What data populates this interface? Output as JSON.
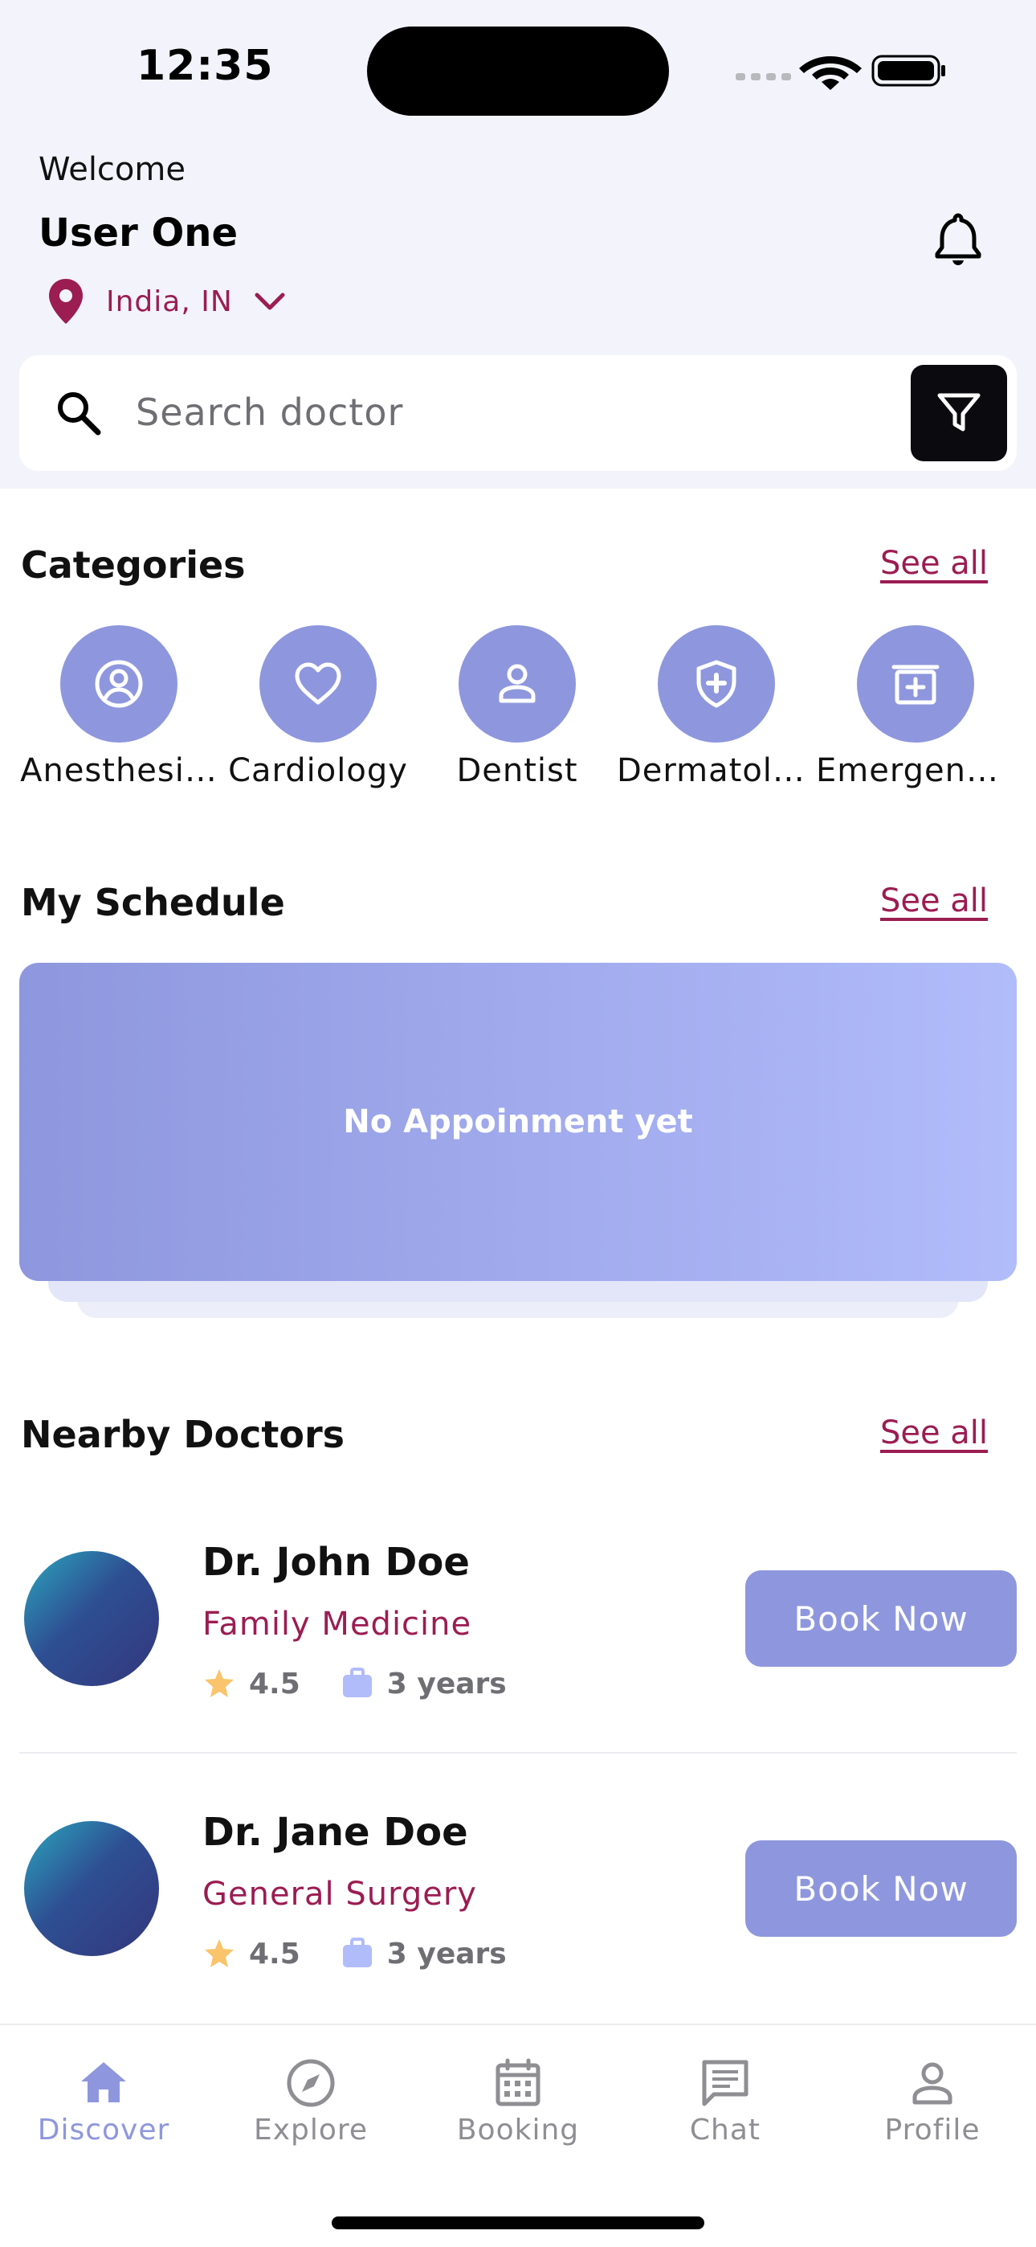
{
  "status_bar": {
    "time": "12:35"
  },
  "header": {
    "welcome": "Welcome",
    "user_name": "User One",
    "location": "India, IN"
  },
  "search": {
    "placeholder": "Search doctor"
  },
  "categories": {
    "title": "Categories",
    "see_all": "See all",
    "items": [
      {
        "label": "Anesthesiology",
        "icon": "user-circle-icon"
      },
      {
        "label": "Cardiology",
        "icon": "heart-icon"
      },
      {
        "label": "Dentist",
        "icon": "person-icon"
      },
      {
        "label": "Dermatology",
        "icon": "shield-plus-icon"
      },
      {
        "label": "Emergency",
        "icon": "first-aid-box-icon"
      }
    ]
  },
  "schedule": {
    "title": "My Schedule",
    "see_all": "See all",
    "empty_text": "No Appoinment yet"
  },
  "nearby": {
    "title": "Nearby Doctors",
    "see_all": "See all",
    "doctors": [
      {
        "name": "Dr. John Doe",
        "specialty": "Family Medicine",
        "rating": "4.5",
        "experience": "3 years",
        "book_label": "Book Now"
      },
      {
        "name": "Dr. Jane Doe",
        "specialty": "General Surgery",
        "rating": "4.5",
        "experience": "3 years",
        "book_label": "Book Now"
      }
    ]
  },
  "tabs": [
    {
      "label": "Discover",
      "icon": "home-icon",
      "active": true
    },
    {
      "label": "Explore",
      "icon": "compass-icon",
      "active": false
    },
    {
      "label": "Booking",
      "icon": "calendar-icon",
      "active": false
    },
    {
      "label": "Chat",
      "icon": "chat-icon",
      "active": false
    },
    {
      "label": "Profile",
      "icon": "profile-icon",
      "active": false
    }
  ],
  "colors": {
    "accent": "#8e97dd",
    "accent_light": "#b1bcfb",
    "brand_text": "#9b1d52",
    "header_bg": "#f3f4fb",
    "filter_button": "#0b0b0f",
    "star": "#f9c46b"
  }
}
